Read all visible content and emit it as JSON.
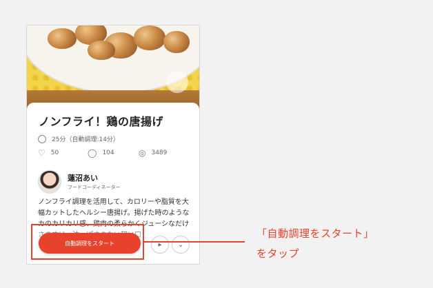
{
  "recipe": {
    "title": "ノンフライ！鶏の唐揚げ",
    "time": "25分（自動調理:14分）",
    "stats": {
      "likes": "50",
      "comments": "104",
      "views": "3489"
    }
  },
  "author": {
    "name": "蓮沼あい",
    "role": "フードコーディネーター"
  },
  "description": "ノンフライ調理を活用して、カロリーや脂質を大幅カットしたヘルシー唐揚げ。揚げた時のようなカのカリカリ感、鶏肉の柔らかくジューシなだけさのすは、油っぽさのない軽い口",
  "actions": {
    "start_label": "自動調理をスタート"
  },
  "annotation": {
    "line1": "「自動調理をスタート」",
    "line2": "をタップ"
  },
  "colors": {
    "accent": "#e8412c"
  },
  "icons": [
    "clock-icon",
    "heart-icon",
    "comment-icon",
    "eye-icon",
    "favorite-icon"
  ]
}
